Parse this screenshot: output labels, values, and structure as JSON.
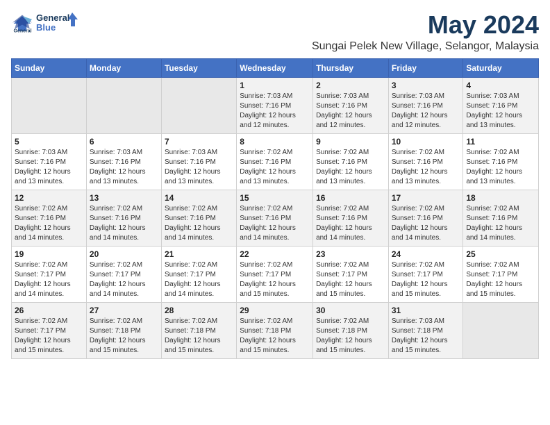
{
  "header": {
    "logo_line1": "General",
    "logo_line2": "Blue",
    "title": "May 2024",
    "subtitle": "Sungai Pelek New Village, Selangor, Malaysia"
  },
  "weekdays": [
    "Sunday",
    "Monday",
    "Tuesday",
    "Wednesday",
    "Thursday",
    "Friday",
    "Saturday"
  ],
  "weeks": [
    [
      {
        "day": "",
        "info": ""
      },
      {
        "day": "",
        "info": ""
      },
      {
        "day": "",
        "info": ""
      },
      {
        "day": "1",
        "info": "Sunrise: 7:03 AM\nSunset: 7:16 PM\nDaylight: 12 hours\nand 12 minutes."
      },
      {
        "day": "2",
        "info": "Sunrise: 7:03 AM\nSunset: 7:16 PM\nDaylight: 12 hours\nand 12 minutes."
      },
      {
        "day": "3",
        "info": "Sunrise: 7:03 AM\nSunset: 7:16 PM\nDaylight: 12 hours\nand 12 minutes."
      },
      {
        "day": "4",
        "info": "Sunrise: 7:03 AM\nSunset: 7:16 PM\nDaylight: 12 hours\nand 13 minutes."
      }
    ],
    [
      {
        "day": "5",
        "info": "Sunrise: 7:03 AM\nSunset: 7:16 PM\nDaylight: 12 hours\nand 13 minutes."
      },
      {
        "day": "6",
        "info": "Sunrise: 7:03 AM\nSunset: 7:16 PM\nDaylight: 12 hours\nand 13 minutes."
      },
      {
        "day": "7",
        "info": "Sunrise: 7:03 AM\nSunset: 7:16 PM\nDaylight: 12 hours\nand 13 minutes."
      },
      {
        "day": "8",
        "info": "Sunrise: 7:02 AM\nSunset: 7:16 PM\nDaylight: 12 hours\nand 13 minutes."
      },
      {
        "day": "9",
        "info": "Sunrise: 7:02 AM\nSunset: 7:16 PM\nDaylight: 12 hours\nand 13 minutes."
      },
      {
        "day": "10",
        "info": "Sunrise: 7:02 AM\nSunset: 7:16 PM\nDaylight: 12 hours\nand 13 minutes."
      },
      {
        "day": "11",
        "info": "Sunrise: 7:02 AM\nSunset: 7:16 PM\nDaylight: 12 hours\nand 13 minutes."
      }
    ],
    [
      {
        "day": "12",
        "info": "Sunrise: 7:02 AM\nSunset: 7:16 PM\nDaylight: 12 hours\nand 14 minutes."
      },
      {
        "day": "13",
        "info": "Sunrise: 7:02 AM\nSunset: 7:16 PM\nDaylight: 12 hours\nand 14 minutes."
      },
      {
        "day": "14",
        "info": "Sunrise: 7:02 AM\nSunset: 7:16 PM\nDaylight: 12 hours\nand 14 minutes."
      },
      {
        "day": "15",
        "info": "Sunrise: 7:02 AM\nSunset: 7:16 PM\nDaylight: 12 hours\nand 14 minutes."
      },
      {
        "day": "16",
        "info": "Sunrise: 7:02 AM\nSunset: 7:16 PM\nDaylight: 12 hours\nand 14 minutes."
      },
      {
        "day": "17",
        "info": "Sunrise: 7:02 AM\nSunset: 7:16 PM\nDaylight: 12 hours\nand 14 minutes."
      },
      {
        "day": "18",
        "info": "Sunrise: 7:02 AM\nSunset: 7:16 PM\nDaylight: 12 hours\nand 14 minutes."
      }
    ],
    [
      {
        "day": "19",
        "info": "Sunrise: 7:02 AM\nSunset: 7:17 PM\nDaylight: 12 hours\nand 14 minutes."
      },
      {
        "day": "20",
        "info": "Sunrise: 7:02 AM\nSunset: 7:17 PM\nDaylight: 12 hours\nand 14 minutes."
      },
      {
        "day": "21",
        "info": "Sunrise: 7:02 AM\nSunset: 7:17 PM\nDaylight: 12 hours\nand 14 minutes."
      },
      {
        "day": "22",
        "info": "Sunrise: 7:02 AM\nSunset: 7:17 PM\nDaylight: 12 hours\nand 15 minutes."
      },
      {
        "day": "23",
        "info": "Sunrise: 7:02 AM\nSunset: 7:17 PM\nDaylight: 12 hours\nand 15 minutes."
      },
      {
        "day": "24",
        "info": "Sunrise: 7:02 AM\nSunset: 7:17 PM\nDaylight: 12 hours\nand 15 minutes."
      },
      {
        "day": "25",
        "info": "Sunrise: 7:02 AM\nSunset: 7:17 PM\nDaylight: 12 hours\nand 15 minutes."
      }
    ],
    [
      {
        "day": "26",
        "info": "Sunrise: 7:02 AM\nSunset: 7:17 PM\nDaylight: 12 hours\nand 15 minutes."
      },
      {
        "day": "27",
        "info": "Sunrise: 7:02 AM\nSunset: 7:18 PM\nDaylight: 12 hours\nand 15 minutes."
      },
      {
        "day": "28",
        "info": "Sunrise: 7:02 AM\nSunset: 7:18 PM\nDaylight: 12 hours\nand 15 minutes."
      },
      {
        "day": "29",
        "info": "Sunrise: 7:02 AM\nSunset: 7:18 PM\nDaylight: 12 hours\nand 15 minutes."
      },
      {
        "day": "30",
        "info": "Sunrise: 7:02 AM\nSunset: 7:18 PM\nDaylight: 12 hours\nand 15 minutes."
      },
      {
        "day": "31",
        "info": "Sunrise: 7:03 AM\nSunset: 7:18 PM\nDaylight: 12 hours\nand 15 minutes."
      },
      {
        "day": "",
        "info": ""
      }
    ]
  ]
}
